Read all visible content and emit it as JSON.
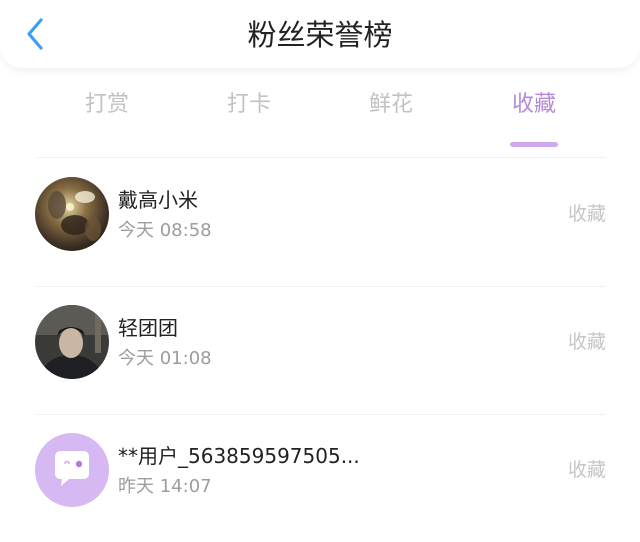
{
  "header": {
    "title": "粉丝荣誉榜",
    "back_icon": "chevron-left-icon"
  },
  "tabs": [
    {
      "label": "打赏",
      "active": false
    },
    {
      "label": "打卡",
      "active": false
    },
    {
      "label": "鲜花",
      "active": false
    },
    {
      "label": "收藏",
      "active": true
    }
  ],
  "colors": {
    "accent": "#b58ad6",
    "back_icon": "#3c9ef7",
    "inactive_text": "#c2c2c2"
  },
  "fans": [
    {
      "name": "戴高小米",
      "time": "今天 08:58",
      "action": "收藏",
      "avatar": "photo-avatar"
    },
    {
      "name": "轻团团",
      "time": "今天 01:08",
      "action": "收藏",
      "avatar": "photo-avatar"
    },
    {
      "name": "**用户_563859597505...",
      "time": "昨天 14:07",
      "action": "收藏",
      "avatar": "default-chat-avatar"
    }
  ]
}
